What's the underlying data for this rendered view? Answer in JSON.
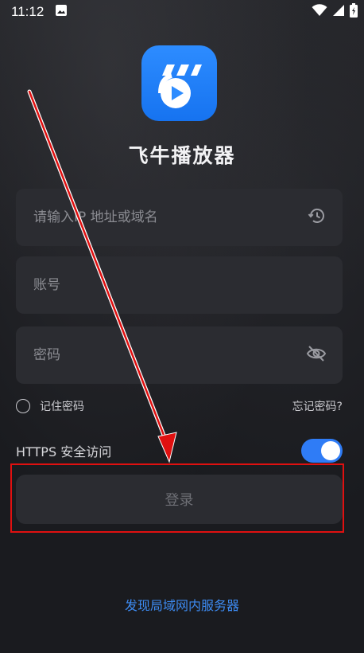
{
  "status_bar": {
    "time": "11:12",
    "icons": [
      "image-icon",
      "wifi-icon",
      "signal-icon",
      "battery-icon"
    ]
  },
  "app": {
    "name": "飞牛播放器",
    "icon": "play-logo-icon",
    "brand_color": "#2d8cff"
  },
  "form": {
    "address_placeholder": "请输入IP 地址或域名",
    "address_value": "",
    "address_icon": "history-icon",
    "account_placeholder": "账号",
    "account_value": "",
    "password_placeholder": "密码",
    "password_value": "",
    "password_icon": "eye-off-icon",
    "remember_label": "记住密码",
    "remember_checked": false,
    "forgot_label": "忘记密码?",
    "https_label": "HTTPS 安全访问",
    "https_enabled": true,
    "login_label": "登录"
  },
  "footer": {
    "discover_label": "发现局域网内服务器"
  },
  "annotation": {
    "highlight_color": "#e01010"
  }
}
